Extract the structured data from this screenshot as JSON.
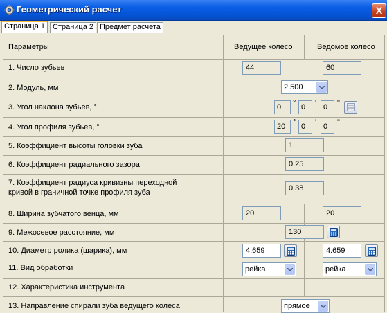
{
  "window": {
    "title": "Геометрический расчет",
    "close_glyph": "X"
  },
  "tabs": [
    {
      "label": "Страница 1",
      "active": true
    },
    {
      "label": "Страница 2",
      "active": false
    },
    {
      "label": "Предмет расчета",
      "active": false
    }
  ],
  "table": {
    "headers": {
      "params": "Параметры",
      "driving": "Ведущее колесо",
      "driven": "Ведомое колесо"
    },
    "rows": {
      "r1": {
        "label": "1. Число зубьев",
        "driving": "44",
        "driven": "60"
      },
      "r2": {
        "label": "2. Модуль, мм",
        "value": "2.500"
      },
      "r3": {
        "label": "3. Угол наклона зубьев, °",
        "deg": "0",
        "min": "0",
        "sec": "0"
      },
      "r4": {
        "label": "4. Угол профиля зубьев, °",
        "deg": "20",
        "min": "0",
        "sec": "0"
      },
      "r5": {
        "label": "5. Коэффициент высоты головки зуба",
        "value": "1"
      },
      "r6": {
        "label": "6. Коэффициент радиального зазора",
        "value": "0.25"
      },
      "r7": {
        "label_line1": "7. Коэффициент радиуса кривизны переходной",
        "label_line2": "кривой в граничной точке профиля зуба",
        "value": "0.38"
      },
      "r8": {
        "label": "8. Ширина зубчатого венца, мм",
        "driving": "20",
        "driven": "20"
      },
      "r9": {
        "label": "9. Межосевое расстояние, мм",
        "value": "130"
      },
      "r10": {
        "label": "10. Диаметр ролика (шарика), мм",
        "driving": "4.659",
        "driven": "4.659"
      },
      "r11": {
        "label": "11. Вид обработки",
        "driving": "рейка",
        "driven": "рейка"
      },
      "r12": {
        "label": "12. Характеристика инструмента"
      },
      "r13": {
        "label": "13. Направление спирали зуба ведущего колеса",
        "value": "прямое"
      }
    },
    "symbols": {
      "degree": "°",
      "minute": "'",
      "second": "\""
    }
  },
  "colors": {
    "title_bar": "#0a5fe6",
    "close_button": "#c6401c",
    "panel": "#ece9d8",
    "grid_line": "#aca899",
    "field_border": "#7f9db9",
    "tab_highlight": "#f8b93d"
  }
}
